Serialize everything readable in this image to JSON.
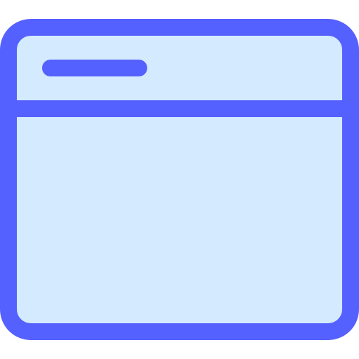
{
  "icon": {
    "name": "browser-window-icon",
    "colors": {
      "stroke": "#5561FF",
      "fill": "#D4EAFF",
      "background": "#FFFFFF"
    }
  }
}
